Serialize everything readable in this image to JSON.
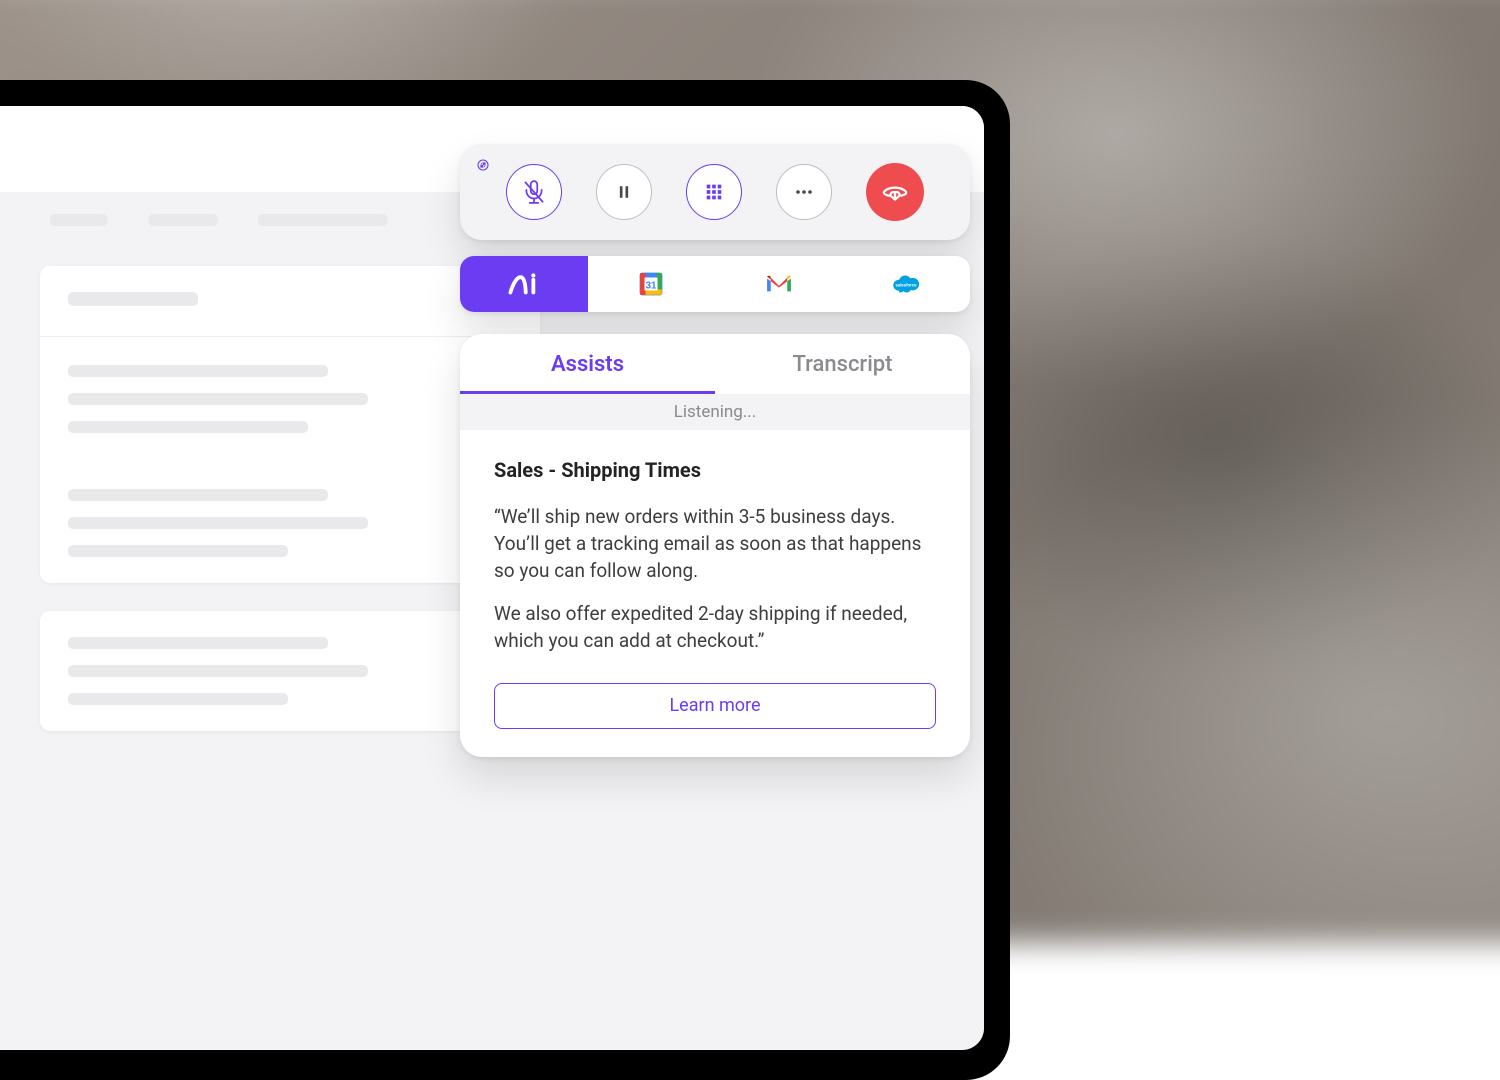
{
  "call_controls": {
    "mute": "mute",
    "pause": "pause",
    "dialpad": "dialpad",
    "more": "more-options",
    "hangup": "hang-up"
  },
  "integrations": {
    "items": [
      {
        "id": "ai",
        "label": "AI Assist"
      },
      {
        "id": "calendar",
        "label": "Google Calendar"
      },
      {
        "id": "gmail",
        "label": "Gmail"
      },
      {
        "id": "salesforce",
        "label": "Salesforce"
      }
    ]
  },
  "assist_panel": {
    "tabs": {
      "assists": "Assists",
      "transcript": "Transcript"
    },
    "listening": "Listening...",
    "card": {
      "title": "Sales - Shipping Times",
      "para1": "“We’ll ship new orders within 3-5 business days. You’ll get a tracking email as soon as that happens so you can follow along.",
      "para2": "We also offer expedited 2-day shipping if needed, which you can add at checkout.”",
      "learn_more": "Learn more"
    }
  }
}
